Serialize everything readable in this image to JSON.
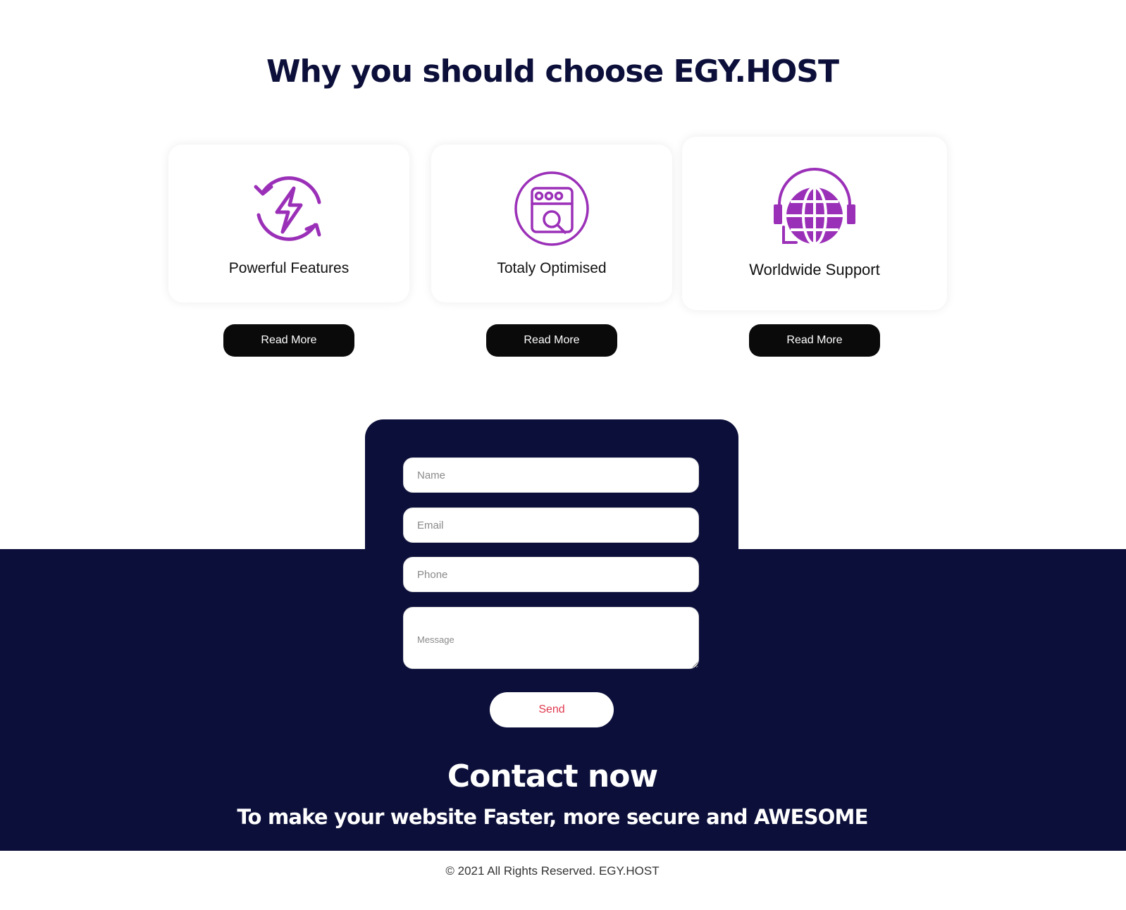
{
  "heading": "Why you should choose EGY.HOST",
  "features": [
    {
      "title": "Powerful Features",
      "icon": "lightning-refresh-icon",
      "button": "Read More"
    },
    {
      "title": "Totaly Optimised",
      "icon": "browser-search-icon",
      "button": "Read More"
    },
    {
      "title": "Worldwide Support",
      "icon": "globe-headset-icon",
      "button": "Read More"
    }
  ],
  "form": {
    "name_placeholder": "Name",
    "email_placeholder": "Email",
    "phone_placeholder": "Phone",
    "message_placeholder": "Message",
    "send_label": "Send"
  },
  "contact": {
    "title": "Contact now",
    "subtitle": "To make your website Faster, more secure and AWESOME"
  },
  "footer": {
    "copyright": "© 2021 All Rights Reserved. EGY.HOST"
  },
  "colors": {
    "navy": "#0c0f3a",
    "accent_purple": "#9b30b8",
    "send_text": "#e0394f"
  }
}
